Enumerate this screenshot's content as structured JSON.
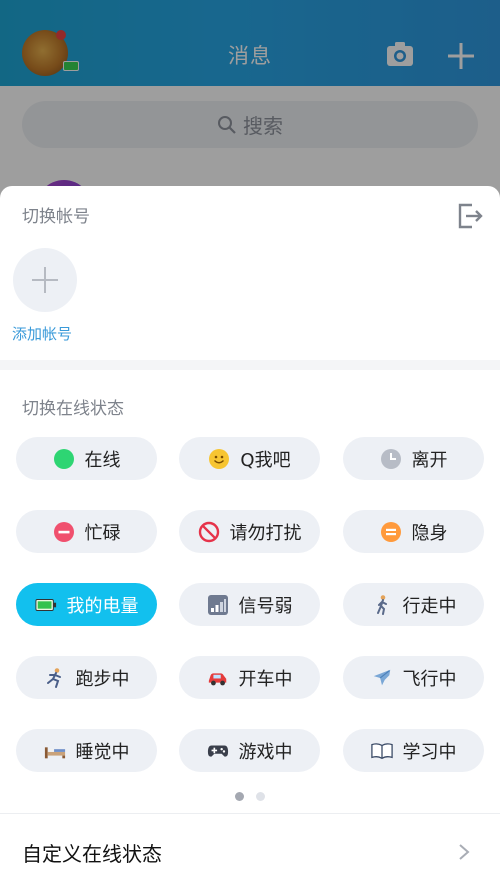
{
  "header": {
    "title": "消息"
  },
  "search": {
    "placeholder": "搜索"
  },
  "sheet": {
    "switch_account_title": "切换帐号",
    "add_account_label": "添加帐号",
    "switch_status_title": "切换在线状态",
    "custom_status_label": "自定义在线状态",
    "statuses": [
      {
        "label": "在线",
        "icon": "green-dot-icon",
        "active": false
      },
      {
        "label": "Q我吧",
        "icon": "smiley-icon",
        "active": false
      },
      {
        "label": "离开",
        "icon": "clock-icon",
        "active": false
      },
      {
        "label": "忙碌",
        "icon": "red-minus-icon",
        "active": false
      },
      {
        "label": "请勿打扰",
        "icon": "no-entry-icon",
        "active": false
      },
      {
        "label": "隐身",
        "icon": "orange-equals-icon",
        "active": false
      },
      {
        "label": "我的电量",
        "icon": "battery-icon",
        "active": true
      },
      {
        "label": "信号弱",
        "icon": "signal-icon",
        "active": false
      },
      {
        "label": "行走中",
        "icon": "walking-icon",
        "active": false
      },
      {
        "label": "跑步中",
        "icon": "running-icon",
        "active": false
      },
      {
        "label": "开车中",
        "icon": "car-icon",
        "active": false
      },
      {
        "label": "飞行中",
        "icon": "airplane-icon",
        "active": false
      },
      {
        "label": "睡觉中",
        "icon": "bed-icon",
        "active": false
      },
      {
        "label": "游戏中",
        "icon": "gamepad-icon",
        "active": false
      },
      {
        "label": "学习中",
        "icon": "book-icon",
        "active": false
      }
    ],
    "page_index": 1,
    "page_count": 2
  },
  "colors": {
    "accent": "#12c0ee",
    "header": "#28a7e6",
    "pill": "#edf0f5"
  }
}
